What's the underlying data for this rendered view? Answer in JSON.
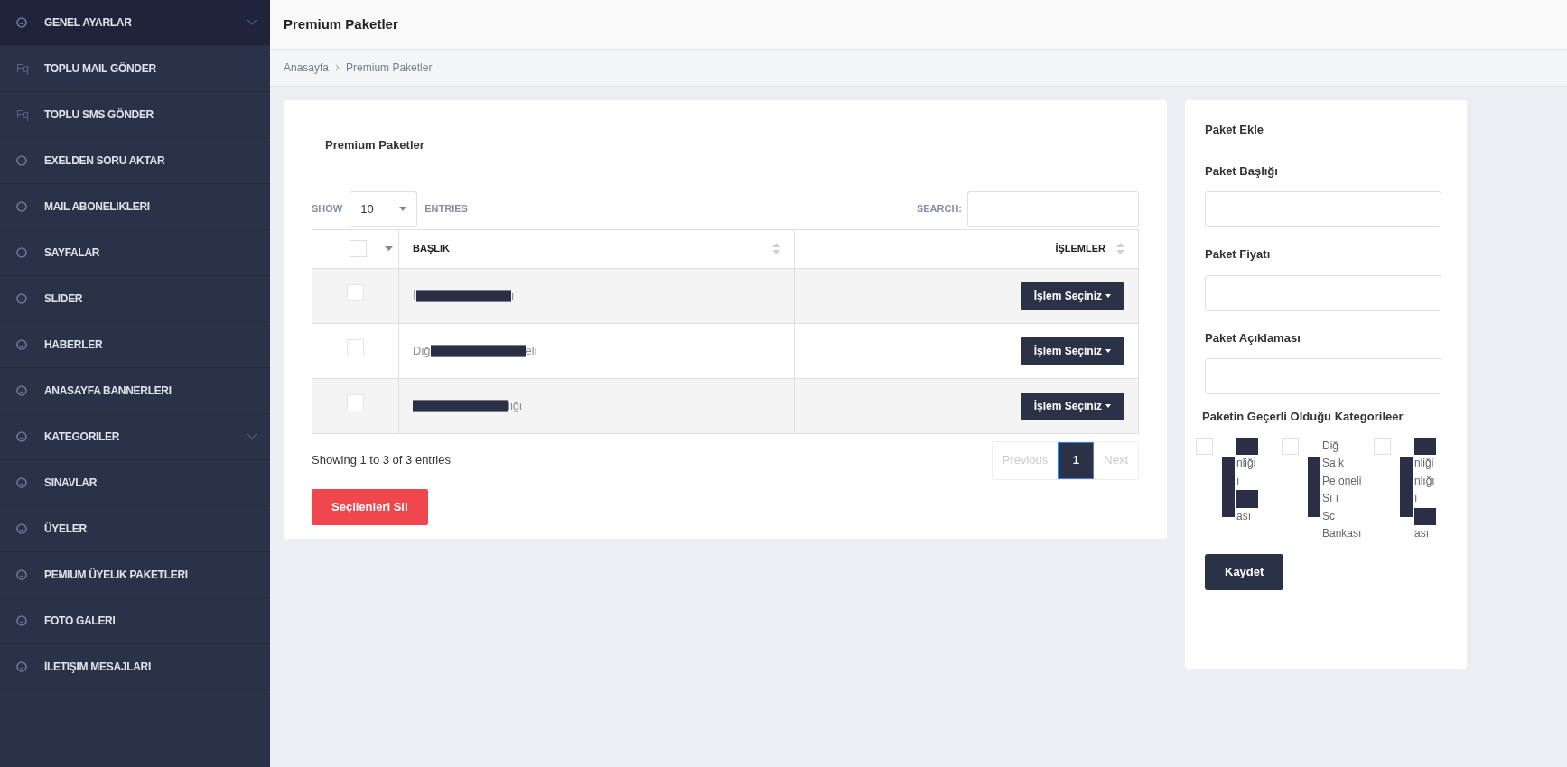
{
  "sidebar": {
    "items": [
      {
        "kind": "gauge",
        "label": "GENEL AYARLAR",
        "expandable": true,
        "selected": true
      },
      {
        "kind": "text",
        "icon_text": "Fq",
        "label": "TOPLU MAIL GÖNDER",
        "expandable": false,
        "selected": false
      },
      {
        "kind": "text",
        "icon_text": "Fq",
        "label": "TOPLU SMS GÖNDER",
        "expandable": false,
        "selected": false
      },
      {
        "kind": "gauge",
        "label": "EXELDEN SORU AKTAR",
        "expandable": false,
        "selected": false
      },
      {
        "kind": "gauge",
        "label": "MAIL ABONELIKLERI",
        "expandable": false,
        "selected": false
      },
      {
        "kind": "gauge",
        "label": "SAYFALAR",
        "expandable": false,
        "selected": false
      },
      {
        "kind": "gauge",
        "label": "SLIDER",
        "expandable": false,
        "selected": false
      },
      {
        "kind": "gauge",
        "label": "HABERLER",
        "expandable": false,
        "selected": false
      },
      {
        "kind": "gauge",
        "label": "ANASAYFA BANNERLERI",
        "expandable": false,
        "selected": false
      },
      {
        "kind": "gauge",
        "label": "KATEGORILER",
        "expandable": true,
        "selected": false
      },
      {
        "kind": "gauge",
        "label": "SINAVLAR",
        "expandable": false,
        "selected": false
      },
      {
        "kind": "gauge",
        "label": "ÜYELER",
        "expandable": false,
        "selected": false
      },
      {
        "kind": "gauge",
        "label": "PEMIUM ÜYELIK PAKETLERI",
        "expandable": false,
        "selected": false
      },
      {
        "kind": "gauge",
        "label": "FOTO GALERI",
        "expandable": false,
        "selected": false
      },
      {
        "kind": "gauge",
        "label": "İLETIŞIM MESAJLARI",
        "expandable": false,
        "selected": false
      }
    ]
  },
  "header": {
    "title": "Premium Paketler"
  },
  "breadcrumb": [
    "Anasayfa",
    "Premium Paketler"
  ],
  "table_card": {
    "title": "Premium Paketler",
    "show_label": "SHOW",
    "page_size": "10",
    "entries_label": "ENTRIES",
    "search_label": "SEARCH:",
    "select_all_checked": false,
    "columns": [
      "BAŞLIK",
      "İŞLEMLER"
    ],
    "rows": [
      {
        "title_start": "İ",
        "title_end": "ı",
        "action": "İşlem Seçiniz",
        "checked": false
      },
      {
        "title_start": "Diğ",
        "title_end": "eli",
        "action": "İşlem Seçiniz",
        "checked": false
      },
      {
        "title_end": "liği",
        "action": "İşlem Seçiniz",
        "checked": false
      }
    ],
    "info": "Showing 1 to 3 of 3 entries",
    "pagination": [
      {
        "label": "Previous",
        "selected": false,
        "disabled": true
      },
      {
        "label": "1",
        "selected": true,
        "disabled": false
      },
      {
        "label": "Next",
        "selected": false,
        "disabled": true
      }
    ],
    "delete_button": "Seçilenleri Sil"
  },
  "form_card": {
    "title": "Paket Ekle",
    "fields": [
      {
        "label": "Paket Başlığı"
      },
      {
        "label": "Paket Fiyatı"
      },
      {
        "label": "Paket Açıklaması"
      }
    ],
    "categories_label": "Paketin Geçerli Olduğu Kategorileer",
    "categories": [
      {
        "checked": false,
        "lines": [
          {
            "redacted": true
          },
          {
            "text": "nliği"
          },
          {
            "text": "ı"
          },
          {
            "redacted": true
          },
          {
            "text": "ası"
          }
        ]
      },
      {
        "checked": false,
        "lines": [
          {
            "text": "Diğ"
          },
          {
            "text": "Sa k"
          },
          {
            "text": "Pe oneli"
          },
          {
            "text": "Sı ı"
          },
          {
            "text": "Sc"
          },
          {
            "text": "Bankası"
          }
        ]
      },
      {
        "checked": false,
        "lines": [
          {
            "redacted": true
          },
          {
            "text": "nliği"
          },
          {
            "text": "nlığı"
          },
          {
            "text": "ı"
          },
          {
            "redacted": true
          },
          {
            "text": "ası"
          }
        ]
      }
    ],
    "save_button": "Kaydet"
  }
}
